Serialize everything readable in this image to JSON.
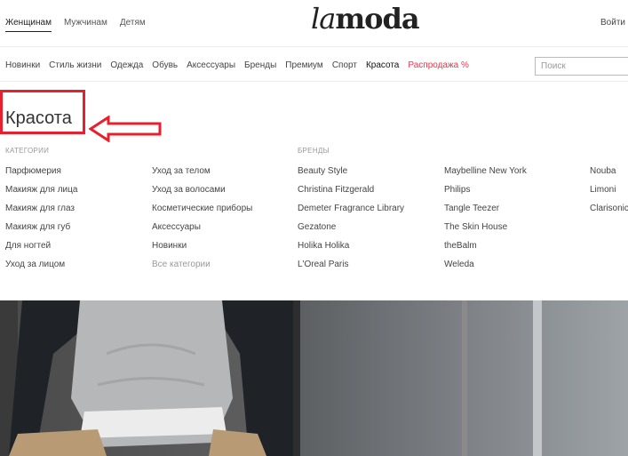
{
  "header": {
    "tabs": [
      "Женщинам",
      "Мужчинам",
      "Детям"
    ],
    "active_tab": 0,
    "logo_light": "la",
    "logo_bold": "moda",
    "login_label": "Войти"
  },
  "nav": {
    "items": [
      "Новинки",
      "Стиль жизни",
      "Одежда",
      "Обувь",
      "Аксессуары",
      "Бренды",
      "Премиум",
      "Спорт",
      "Красота",
      "Распродажа %"
    ],
    "active_index": 8,
    "sale_index": 9,
    "search_placeholder": "Поиск"
  },
  "menu": {
    "title": "Красота",
    "categories_heading": "КАТЕГОРИИ",
    "brands_heading": "БРЕНДЫ",
    "categories_col1": [
      "Парфюмерия",
      "Макияж для лица",
      "Макияж для глаз",
      "Макияж для губ",
      "Для ногтей",
      "Уход за лицом"
    ],
    "categories_col2": [
      "Уход за телом",
      "Уход за волосами",
      "Косметические приборы",
      "Аксессуары",
      "Новинки",
      "Все категории"
    ],
    "brands_col1": [
      "Beauty Style",
      "Christina Fitzgerald",
      "Demeter Fragrance Library",
      "Gezatone",
      "Holika Holika",
      "L'Oreal Paris"
    ],
    "brands_col2": [
      "Maybelline New York",
      "Philips",
      "Tangle Teezer",
      "The Skin House",
      "theBalm",
      "Weleda"
    ],
    "brands_col3": [
      "Nouba",
      "Limoni",
      "Clarisonic"
    ]
  },
  "colors": {
    "sale": "#e5364b",
    "highlight": "#e8202e"
  }
}
